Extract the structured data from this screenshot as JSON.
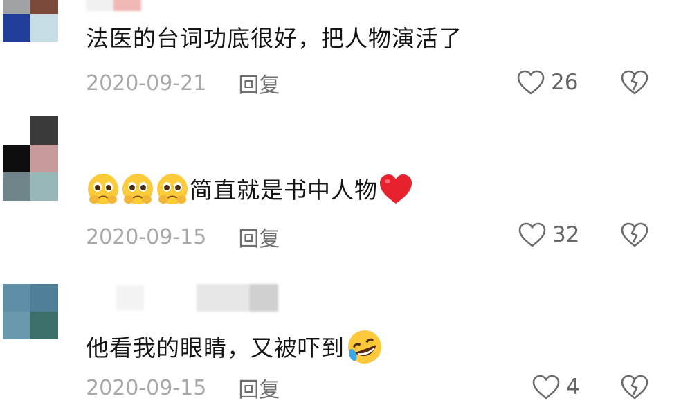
{
  "comments": [
    {
      "text": "法医的台词功底很好，把人物演活了",
      "date": "2020-09-21",
      "reply_label": "回复",
      "likes": "26",
      "avatar_colors": [
        "#9fa3a6",
        "#7b4a38",
        "#213f9a",
        "#c6dde6"
      ],
      "emoji_after": []
    },
    {
      "text": "简直就是书中人物",
      "date": "2020-09-15",
      "reply_label": "回复",
      "likes": "32",
      "avatar_colors": [
        "#2b2b2b",
        "#c79b9b",
        "#70858a",
        "#98b7b8"
      ],
      "emoji_before": [
        "pleading-face-icon",
        "pleading-face-icon",
        "pleading-face-icon"
      ],
      "emoji_after": [
        "red-heart-icon"
      ]
    },
    {
      "text": "他看我的眼睛，又被吓到",
      "date": "2020-09-15",
      "reply_label": "回复",
      "likes": "4",
      "avatar_colors": [
        "#5e8fa6",
        "#4f7f96",
        "#6a98ad",
        "#3c6f6a"
      ],
      "emoji_after": [
        "rolling-laughing-icon"
      ]
    }
  ]
}
